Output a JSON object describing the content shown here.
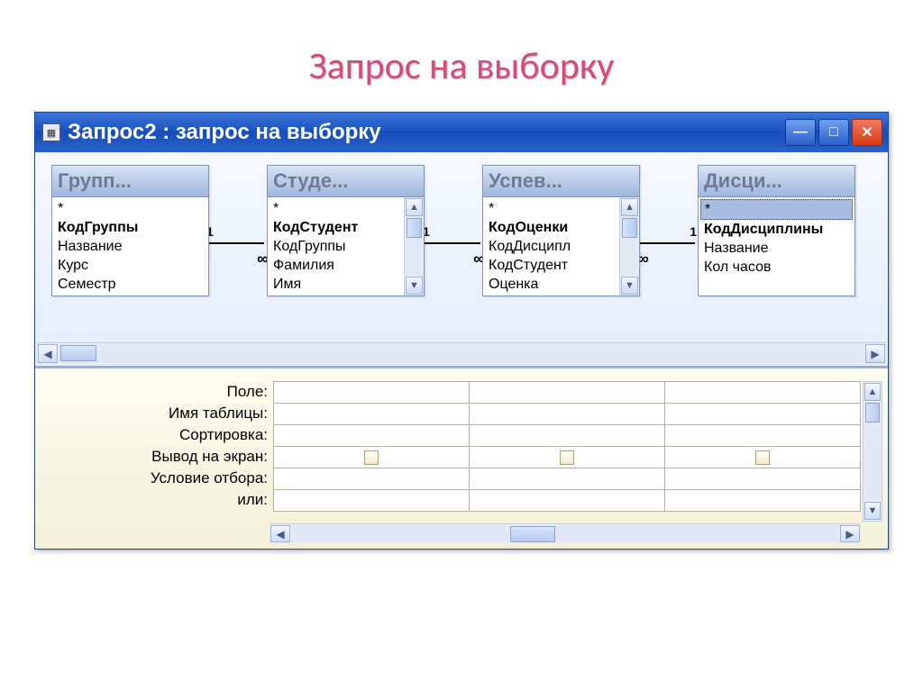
{
  "slide_title": "Запрос на выборку",
  "window_title": "Запрос2 : запрос на выборку",
  "tables": [
    {
      "title": "Групп...",
      "has_scroll": false,
      "fields": [
        {
          "label": "*",
          "bold": false
        },
        {
          "label": "КодГруппы",
          "bold": true
        },
        {
          "label": "Название",
          "bold": false
        },
        {
          "label": "Курс",
          "bold": false
        },
        {
          "label": "Семестр",
          "bold": false
        }
      ]
    },
    {
      "title": "Студе...",
      "has_scroll": true,
      "fields": [
        {
          "label": "*",
          "bold": false
        },
        {
          "label": "КодСтудент",
          "bold": true
        },
        {
          "label": "КодГруппы",
          "bold": false
        },
        {
          "label": "Фамилия",
          "bold": false
        },
        {
          "label": "Имя",
          "bold": false
        }
      ]
    },
    {
      "title": "Успев...",
      "has_scroll": true,
      "fields": [
        {
          "label": "*",
          "bold": false
        },
        {
          "label": "КодОценки",
          "bold": true
        },
        {
          "label": "КодДисципл",
          "bold": false
        },
        {
          "label": "КодСтудент",
          "bold": false
        },
        {
          "label": "Оценка",
          "bold": false
        }
      ]
    },
    {
      "title": "Дисци...",
      "has_scroll": false,
      "fields": [
        {
          "label": "*",
          "bold": false,
          "selected": true
        },
        {
          "label": "КодДисциплины",
          "bold": true
        },
        {
          "label": "Название",
          "bold": false
        },
        {
          "label": "Кол часов",
          "bold": false
        }
      ]
    }
  ],
  "rel_one": "1",
  "rel_many": "∞",
  "grid_labels": {
    "field": "Поле:",
    "table": "Имя таблицы:",
    "sort": "Сортировка:",
    "show": "Вывод на экран:",
    "criteria": "Условие отбора:",
    "or": "или:"
  }
}
